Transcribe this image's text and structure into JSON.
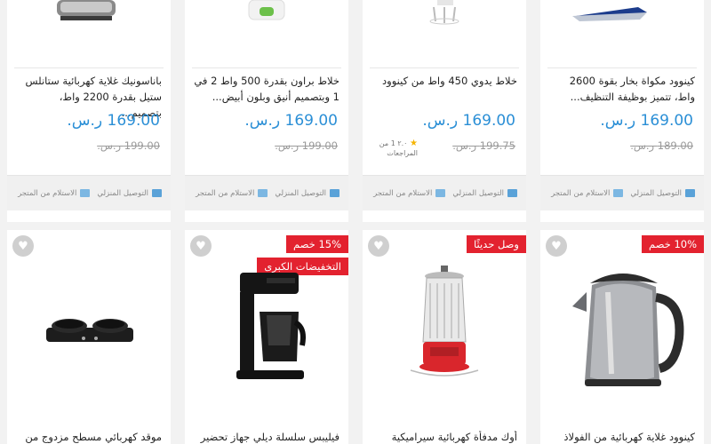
{
  "currency": "ر.س",
  "top_products": [
    {
      "title": "كينوود مكواة بخار بقوة 2600 واط، تتميز بوظيفة التنظيف...",
      "price": "169.00 ر.س.",
      "old_price": "189.00 ر.س.",
      "rating": null
    },
    {
      "title": "خلاط يدوي 450 واط من كينوود",
      "price": "169.00 ر.س.",
      "old_price": "199.75 ر.س.",
      "rating": {
        "value": "٢.٠",
        "count_text": "1 من المراجعات"
      }
    },
    {
      "title": "خلاط براون بقدرة 500 واط 2 في 1 وبتصميم أنيق وبلون أبيض...",
      "price": "169.00 ر.س.",
      "old_price": "199.00 ر.س.",
      "rating": null
    },
    {
      "title": "باناسونيك غلاية كهربائية ستانلس ستيل بقدرة 2200 واط، بتصميم...",
      "price": "169.00 ر.س.",
      "old_price": "199.00 ر.س.",
      "rating": null
    }
  ],
  "footer": {
    "delivery": "التوصيل المنزلي",
    "pickup": "الاستلام من المتجر"
  },
  "bottom_products": [
    {
      "title": "كينوود غلاية كهربائية من الفولاذ",
      "badge": "10% خصم",
      "badge2": ""
    },
    {
      "title": "أوك مدفأة كهربائية سيراميكية",
      "badge": "وصل حديثًا",
      "badge2": ""
    },
    {
      "title": "فيليبس سلسلة ديلي جهاز تحضير",
      "badge": "15% خصم",
      "badge2": "التخفيضات الكبرى"
    },
    {
      "title": "موقد كهربائي مسطح مزدوج من",
      "badge": "",
      "badge2": ""
    }
  ]
}
